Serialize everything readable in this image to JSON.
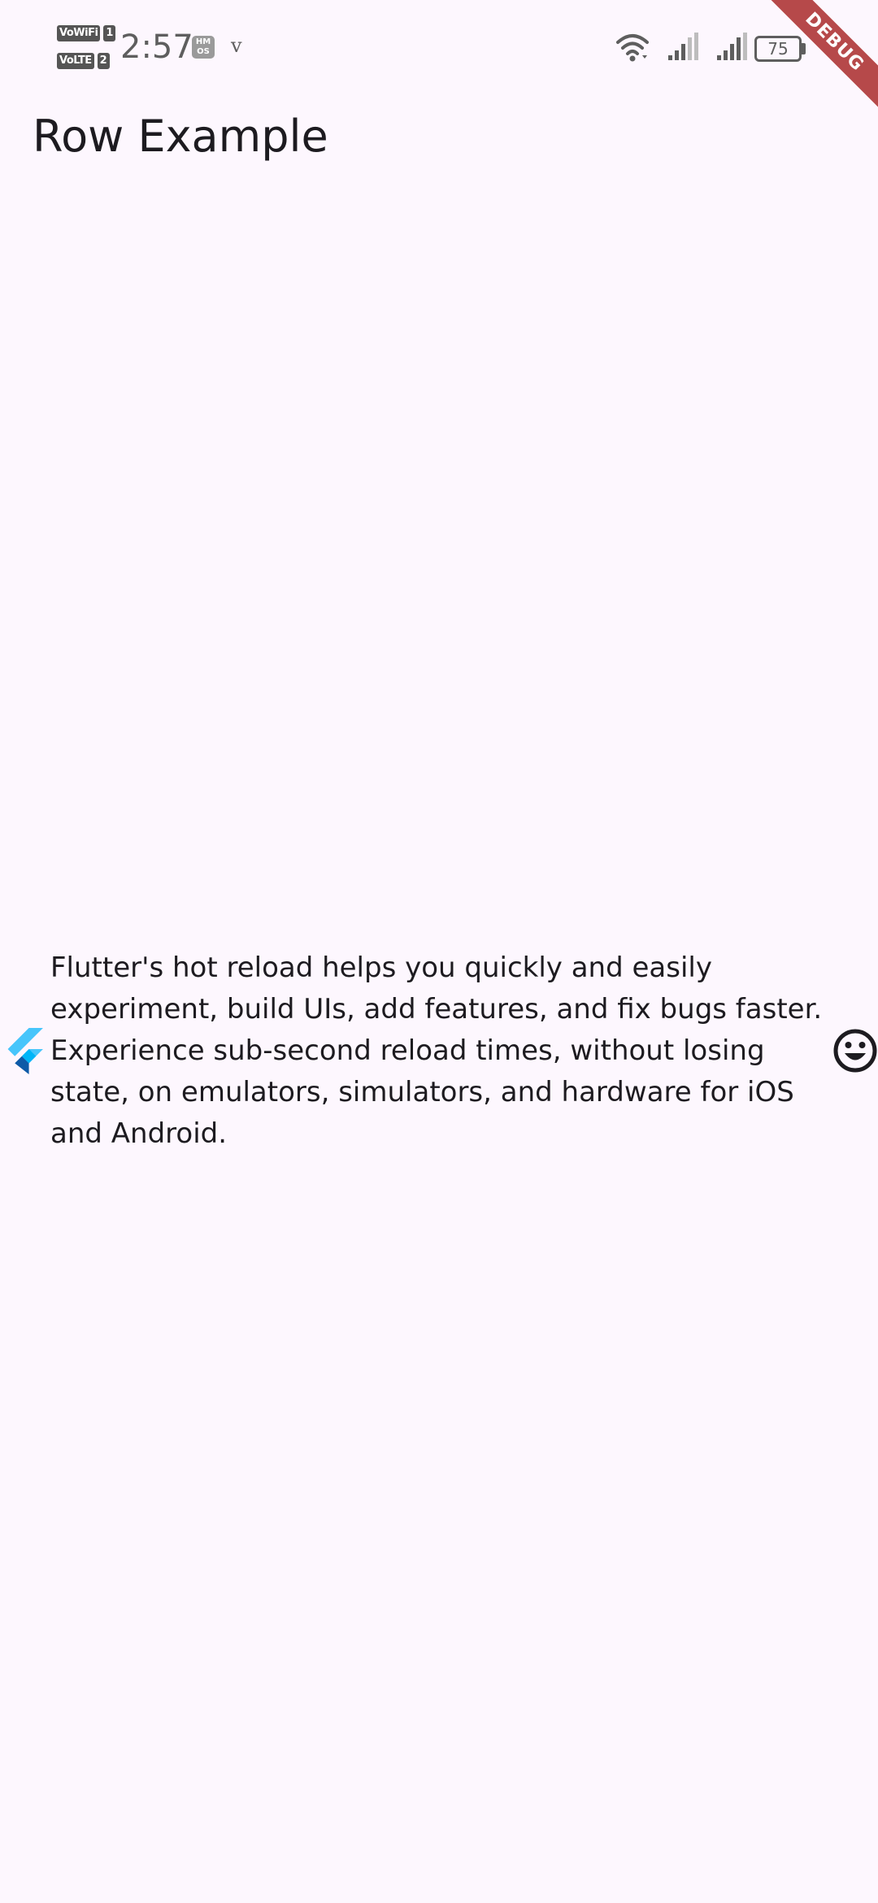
{
  "status_bar": {
    "network_tags": [
      {
        "tag": "VoWiFi",
        "slot": "1"
      },
      {
        "tag": "VoLTE",
        "slot": "2"
      }
    ],
    "time": "2:57",
    "os_badge": "HM OS",
    "carrier_mark": "v",
    "battery_level": "75",
    "icons": [
      "wifi-icon",
      "signal-icon",
      "signal-icon",
      "battery-icon"
    ],
    "icon_color": "#5e5e5e"
  },
  "debug_banner": {
    "label": "DEBUG",
    "color": "#b13b3b"
  },
  "app_bar": {
    "title": "Row Example"
  },
  "row": {
    "leading_icon": "flutter-logo-icon",
    "text": "Flutter's hot reload helps you quickly and easily experiment, build UIs, add features, and fix bugs faster. Experience sub-second reload times, without losing state, on emulators, simulators, and hardware for iOS and Android.",
    "trailing_icon": "sentiment-very-satisfied-icon"
  },
  "colors": {
    "background": "#fdf7fe",
    "text": "#1d1b20",
    "flutter_light_blue": "#47c5fb",
    "flutter_dark_blue": "#0d5aa7"
  }
}
